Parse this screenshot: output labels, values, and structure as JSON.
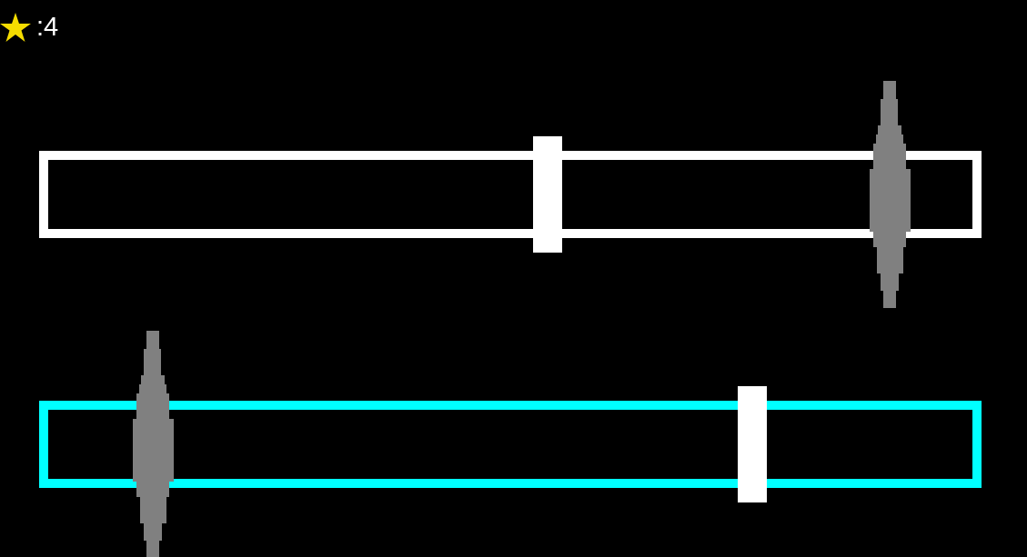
{
  "score": {
    "text": ":4"
  },
  "tracks": [
    {
      "selected": false,
      "level": 0.5404,
      "target": {
        "level": 0.911
      }
    },
    {
      "selected": true,
      "level": 0.7618,
      "target": {
        "level": 0.1137
      }
    }
  ]
}
